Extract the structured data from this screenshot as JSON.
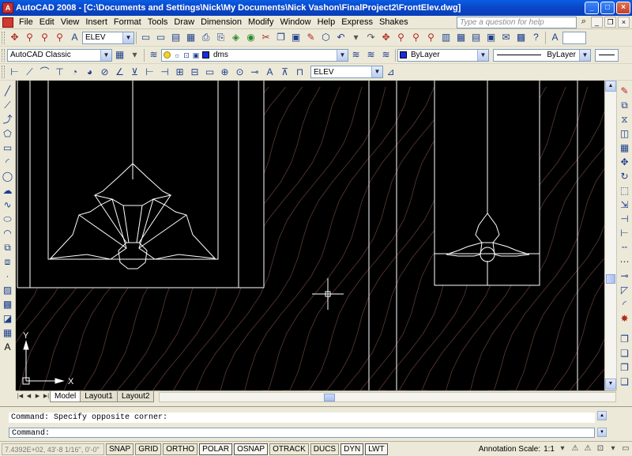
{
  "window": {
    "title": "AutoCAD 2008 - [C:\\Documents and Settings\\Nick\\My Documents\\Nick Vashon\\FinalProject2\\FrontElev.dwg]",
    "controls": [
      "_",
      "□",
      "×"
    ]
  },
  "menubar": {
    "items": [
      "File",
      "Edit",
      "View",
      "Insert",
      "Format",
      "Tools",
      "Draw",
      "Dimension",
      "Modify",
      "Window",
      "Help",
      "Express",
      "Shakes"
    ],
    "search_placeholder": "Type a question for help"
  },
  "toolbar_standard": {
    "textstyle_value": "ELEV",
    "dimstyle_value": "A"
  },
  "toolbar_layers": {
    "workspace_value": "AutoCAD Classic",
    "layer_value": "dms",
    "color_value": "ByLayer",
    "linetype_value": "ByLayer",
    "layer_color": "#1a2be0"
  },
  "toolbar_dimension": {
    "dimstyle_value": "ELEV"
  },
  "ucs": {
    "x_label": "X",
    "y_label": "Y"
  },
  "layout_tabs": [
    "Model",
    "Layout1",
    "Layout2"
  ],
  "active_tab": "Model",
  "command": {
    "history": "Command: Specify opposite corner:",
    "prompt": "Command:"
  },
  "statusbar": {
    "coordinates": "7.4392E+02, 43'-8 1/16\", 0'-0\"",
    "toggles": [
      {
        "label": "SNAP",
        "on": false
      },
      {
        "label": "GRID",
        "on": false
      },
      {
        "label": "ORTHO",
        "on": false
      },
      {
        "label": "POLAR",
        "on": true
      },
      {
        "label": "OSNAP",
        "on": true
      },
      {
        "label": "OTRACK",
        "on": false
      },
      {
        "label": "DUCS",
        "on": false
      },
      {
        "label": "DYN",
        "on": true
      },
      {
        "label": "LWT",
        "on": true
      }
    ],
    "annotation_scale_label": "Annotation Scale:",
    "annotation_scale_value": "1:1"
  },
  "colors": {
    "canvas_bg": "#000000",
    "drawing_lines": "#ffffff",
    "wood_grain": "#5a3a34",
    "titlebar": "#0b47c9"
  }
}
